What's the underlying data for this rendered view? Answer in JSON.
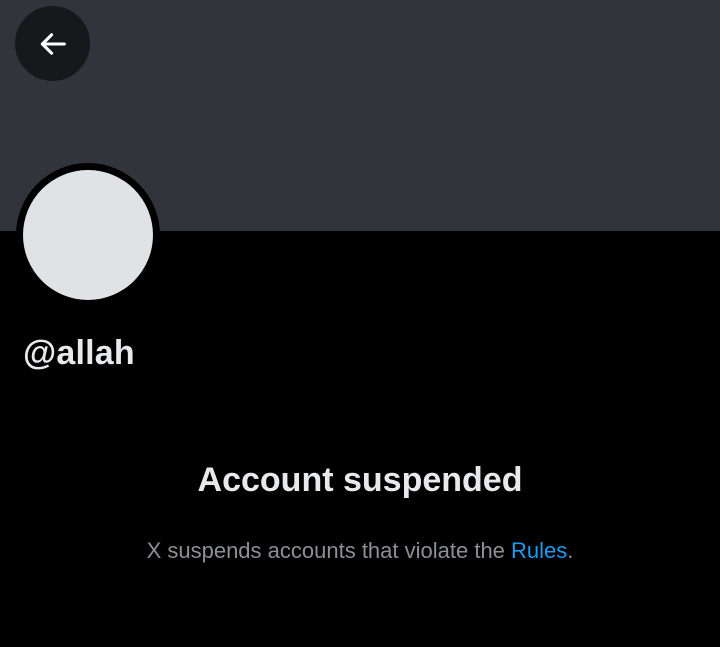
{
  "profile": {
    "handle": "@allah"
  },
  "suspension": {
    "title": "Account suspended",
    "description_prefix": "X suspends accounts that violate the ",
    "rules_link": "Rules",
    "description_suffix": "."
  },
  "icons": {
    "back": "arrow-left-icon"
  },
  "colors": {
    "banner": "#31343a",
    "background": "#000000",
    "avatar": "#e0e3e6",
    "text_primary": "#e7e9ea",
    "text_secondary": "#8b9096",
    "link": "#1d9bf0"
  }
}
